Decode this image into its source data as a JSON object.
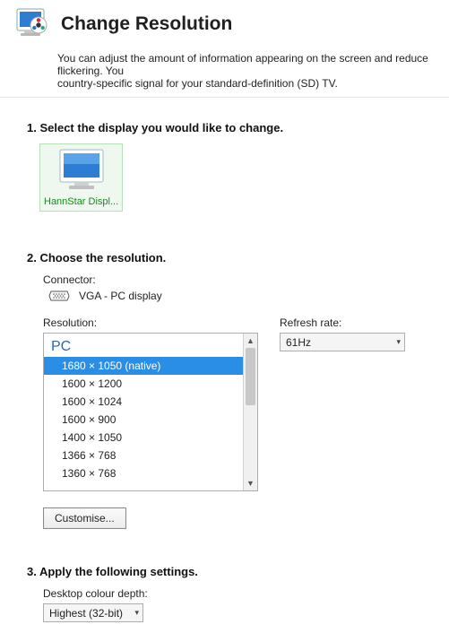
{
  "header": {
    "title": "Change Resolution",
    "description_line1": "You can adjust the amount of information appearing on the screen and reduce flickering. You",
    "description_line2": "country-specific signal for your standard-definition (SD) TV."
  },
  "step1": {
    "title": "1. Select the display you would like to change.",
    "display_label": "HannStar Displ..."
  },
  "step2": {
    "title": "2. Choose the resolution.",
    "connector_label": "Connector:",
    "connector_value": "VGA - PC display",
    "resolution_label": "Resolution:",
    "refresh_label": "Refresh rate:",
    "refresh_value": "61Hz",
    "res_group_label": "PC",
    "resolutions": [
      "1680 × 1050 (native)",
      "1600 × 1200",
      "1600 × 1024",
      "1600 × 900",
      "1400 × 1050",
      "1366 × 768",
      "1360 × 768"
    ],
    "customise_label": "Customise..."
  },
  "step3": {
    "title": "3. Apply the following settings.",
    "depth_label": "Desktop colour depth:",
    "depth_value": "Highest (32-bit)"
  }
}
